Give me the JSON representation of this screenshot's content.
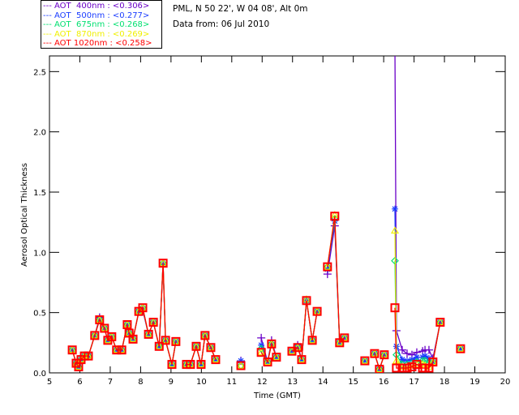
{
  "header": {
    "location": "PML, N 50 22', W 04 08', Alt 0m",
    "date": "Data from: 06 Jul 2010"
  },
  "chart_data": {
    "type": "line",
    "xlabel": "Time (GMT)",
    "ylabel": "Aerosol Optical Thickness",
    "xlim": [
      5,
      20
    ],
    "ylim": [
      0,
      2.63
    ],
    "xticks": [
      "5",
      "6",
      "7",
      "8",
      "9",
      "10",
      "11",
      "12",
      "13",
      "14",
      "15",
      "16",
      "17",
      "18",
      "19",
      "20"
    ],
    "yticks": [
      "0.0",
      "0.5",
      "1.0",
      "1.5",
      "2.0",
      "2.5"
    ],
    "grid": false,
    "legend_placement": "top-left, outside",
    "x": [
      5.75,
      5.88,
      5.96,
      6.04,
      6.15,
      6.28,
      6.49,
      6.65,
      6.81,
      6.92,
      7.05,
      7.21,
      7.38,
      7.56,
      7.62,
      7.75,
      7.94,
      8.07,
      8.26,
      8.42,
      8.61,
      8.74,
      8.82,
      9.03,
      9.16,
      9.51,
      9.64,
      9.83,
      9.99,
      10.12,
      10.31,
      10.47,
      11.3,
      11.97,
      12.18,
      12.31,
      12.47,
      12.98,
      13.17,
      13.3,
      13.46,
      13.65,
      13.81,
      14.15,
      14.39,
      14.55,
      14.71,
      15.38,
      15.7,
      15.86,
      16.02,
      16.37,
      16.42,
      16.61,
      16.77,
      16.93,
      17.09,
      17.28,
      17.36,
      17.49,
      17.62,
      17.86,
      18.53
    ],
    "series": [
      {
        "name": "AOT  400nm : <0.306>",
        "color": "#6a00c8",
        "marker": "plus",
        "values": [
          0.19,
          0.08,
          0.05,
          0.11,
          0.14,
          0.14,
          0.31,
          0.46,
          0.37,
          0.27,
          0.3,
          0.19,
          0.19,
          0.4,
          0.33,
          0.28,
          0.51,
          0.52,
          0.32,
          0.42,
          0.22,
          0.9,
          0.27,
          0.07,
          0.26,
          0.07,
          0.07,
          0.22,
          0.07,
          0.31,
          0.21,
          0.11,
          0.1,
          0.29,
          0.09,
          0.27,
          0.13,
          0.18,
          0.23,
          0.11,
          0.6,
          0.27,
          0.51,
          0.82,
          1.22,
          0.25,
          0.29,
          0.1,
          0.16,
          0.03,
          0.15,
          2.7,
          0.35,
          0.19,
          0.16,
          0.15,
          0.17,
          0.18,
          0.19,
          0.19,
          0.12,
          0.42,
          0.2
        ]
      },
      {
        "name": "AOT  500nm : <0.277>",
        "color": "#1a3cff",
        "marker": "asterisk",
        "values": [
          0.19,
          0.08,
          0.05,
          0.11,
          0.14,
          0.14,
          0.31,
          0.44,
          0.37,
          0.27,
          0.3,
          0.19,
          0.19,
          0.4,
          0.33,
          0.28,
          0.51,
          0.53,
          0.32,
          0.42,
          0.22,
          0.9,
          0.27,
          0.07,
          0.26,
          0.07,
          0.07,
          0.22,
          0.07,
          0.31,
          0.21,
          0.11,
          0.1,
          0.23,
          0.09,
          0.25,
          0.13,
          0.18,
          0.21,
          0.11,
          0.6,
          0.27,
          0.51,
          0.86,
          1.26,
          0.25,
          0.29,
          0.1,
          0.16,
          0.03,
          0.15,
          1.36,
          0.22,
          0.11,
          0.1,
          0.11,
          0.13,
          0.13,
          0.14,
          0.12,
          0.09,
          0.42,
          0.2
        ]
      },
      {
        "name": "AOT  675nm : <0.268>",
        "color": "#00e070",
        "marker": "diamond",
        "values": [
          0.19,
          0.08,
          0.05,
          0.11,
          0.14,
          0.14,
          0.31,
          0.44,
          0.37,
          0.27,
          0.3,
          0.19,
          0.19,
          0.4,
          0.33,
          0.28,
          0.51,
          0.54,
          0.32,
          0.42,
          0.22,
          0.91,
          0.27,
          0.07,
          0.26,
          0.07,
          0.07,
          0.22,
          0.07,
          0.31,
          0.21,
          0.11,
          0.06,
          0.2,
          0.09,
          0.24,
          0.13,
          0.18,
          0.21,
          0.11,
          0.6,
          0.27,
          0.51,
          0.88,
          1.28,
          0.25,
          0.29,
          0.1,
          0.16,
          0.03,
          0.15,
          0.93,
          0.15,
          0.07,
          0.07,
          0.08,
          0.09,
          0.1,
          0.1,
          0.08,
          0.09,
          0.42,
          0.2
        ]
      },
      {
        "name": "AOT  870nm : <0.269>",
        "color": "#f0f000",
        "marker": "triangle",
        "values": [
          0.19,
          0.08,
          0.05,
          0.11,
          0.14,
          0.14,
          0.31,
          0.44,
          0.37,
          0.27,
          0.3,
          0.19,
          0.19,
          0.4,
          0.33,
          0.28,
          0.51,
          0.54,
          0.32,
          0.42,
          0.22,
          0.91,
          0.27,
          0.07,
          0.26,
          0.07,
          0.07,
          0.22,
          0.07,
          0.31,
          0.21,
          0.11,
          0.06,
          0.17,
          0.09,
          0.24,
          0.13,
          0.18,
          0.21,
          0.11,
          0.61,
          0.27,
          0.51,
          0.88,
          1.31,
          0.25,
          0.29,
          0.1,
          0.16,
          0.03,
          0.15,
          1.18,
          0.1,
          0.05,
          0.05,
          0.06,
          0.07,
          0.07,
          0.06,
          0.05,
          0.09,
          0.42,
          0.2
        ]
      },
      {
        "name": "AOT 1020nm : <0.258>",
        "color": "#ff0000",
        "marker": "square",
        "values": [
          0.19,
          0.08,
          0.05,
          0.11,
          0.14,
          0.14,
          0.31,
          0.44,
          0.37,
          0.27,
          0.3,
          0.19,
          0.19,
          0.4,
          0.33,
          0.28,
          0.51,
          0.54,
          0.32,
          0.42,
          0.22,
          0.91,
          0.27,
          0.07,
          0.26,
          0.07,
          0.07,
          0.22,
          0.07,
          0.31,
          0.21,
          0.11,
          0.06,
          0.17,
          0.09,
          0.24,
          0.13,
          0.18,
          0.21,
          0.11,
          0.6,
          0.27,
          0.51,
          0.88,
          1.3,
          0.25,
          0.29,
          0.1,
          0.16,
          0.03,
          0.15,
          0.54,
          0.04,
          0.04,
          0.04,
          0.05,
          0.07,
          0.04,
          0.04,
          0.04,
          0.09,
          0.42,
          0.2
        ]
      }
    ]
  }
}
